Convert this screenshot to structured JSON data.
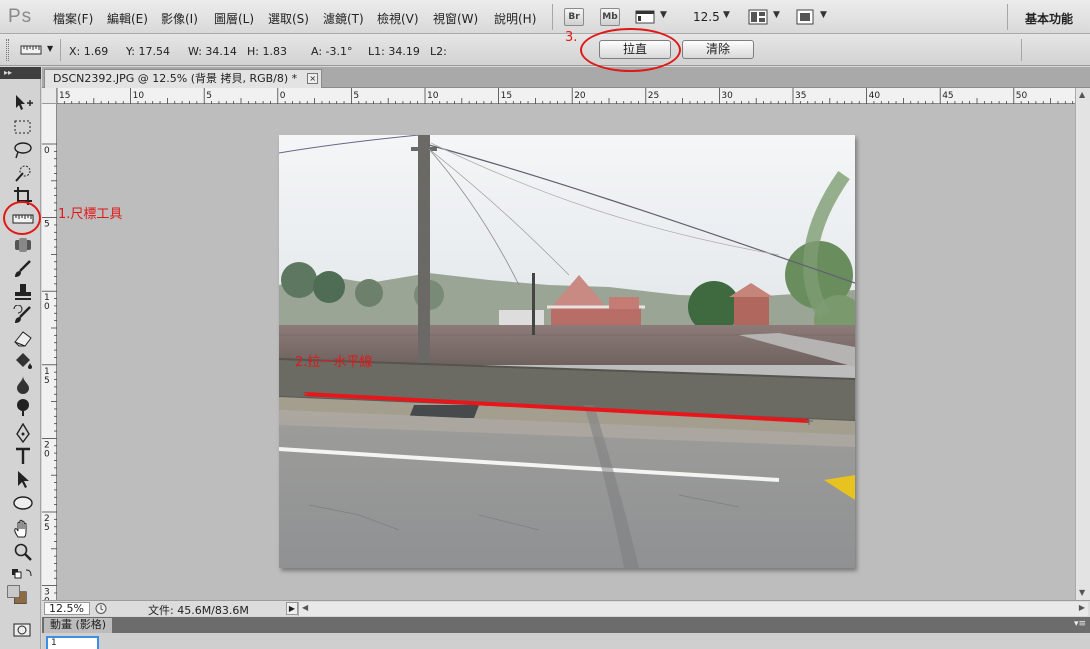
{
  "app": {
    "logo": "Ps"
  },
  "menubar": {
    "items": [
      "檔案(F)",
      "編輯(E)",
      "影像(I)",
      "圖層(L)",
      "選取(S)",
      "濾鏡(T)",
      "檢視(V)",
      "視窗(W)",
      "說明(H)"
    ],
    "bridge_label": "Br",
    "minibridge_label": "Mb",
    "zoom": "12.5",
    "workspace": "基本功能"
  },
  "options": {
    "x": "X: 1.69",
    "y": "Y: 17.54",
    "w": "W: 34.14",
    "h": "H: 1.83",
    "a": "A: -3.1°",
    "l1": "L1: 34.19",
    "l2": "L2:",
    "straighten_label": "拉直",
    "clear_label": "清除"
  },
  "document": {
    "tab_title": "DSCN2392.JPG @ 12.5% (背景 拷貝, RGB/8) *",
    "close_glyph": "×"
  },
  "rulers": {
    "horizontal": [
      "15",
      "10",
      "5",
      "0",
      "5",
      "10",
      "15",
      "20",
      "25",
      "30",
      "35",
      "40",
      "45",
      "50"
    ],
    "vertical": [
      "0",
      "5",
      "1\n0",
      "1\n5",
      "2\n0",
      "2\n5",
      "3\n0"
    ]
  },
  "status": {
    "zoom": "12.5%",
    "doc_info": "文件: 45.6M/83.6M"
  },
  "panel": {
    "tab": "動畫 (影格)",
    "frame_label": "1"
  },
  "annotations": {
    "step1": "1.尺標工具",
    "step2": "2.拉一水平線",
    "step3": "3."
  },
  "colors": {
    "annotation": "#e01818",
    "canvas_bg": "#bdbdbd",
    "measure_line": "#e8161a"
  },
  "icons": [
    "ruler-icon",
    "move-icon",
    "marquee-icon",
    "lasso-icon",
    "quick-select-icon",
    "crop-icon",
    "spot-heal-icon",
    "brush-icon",
    "stamp-icon",
    "history-brush-icon",
    "eraser-icon",
    "bucket-icon",
    "blur-icon",
    "dodge-icon",
    "pen-icon",
    "type-icon",
    "path-select-icon",
    "ellipse-icon",
    "hand-icon",
    "zoom-icon"
  ]
}
